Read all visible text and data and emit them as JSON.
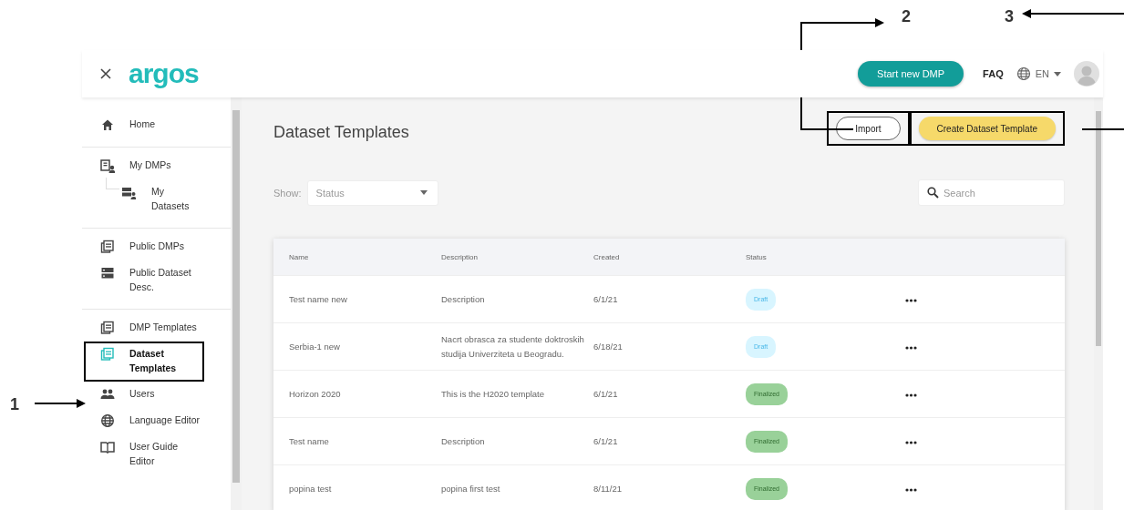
{
  "annotations": [
    {
      "label": "1"
    },
    {
      "label": "2"
    },
    {
      "label": "3"
    }
  ],
  "header": {
    "logo": "argos",
    "start_button": "Start new DMP",
    "faq": "FAQ",
    "language": "EN"
  },
  "sidebar": {
    "sections": [
      {
        "items": [
          {
            "label": "Home",
            "selected": false,
            "highlighted": false
          }
        ]
      },
      {
        "items": [
          {
            "label": "My DMPs",
            "selected": false,
            "highlighted": false,
            "children": [
              {
                "label": "My Datasets",
                "selected": false,
                "highlighted": false
              }
            ]
          }
        ]
      },
      {
        "items": [
          {
            "label": "Public DMPs",
            "selected": false,
            "highlighted": false
          },
          {
            "label": "Public Dataset Desc.",
            "selected": false,
            "highlighted": false
          }
        ]
      },
      {
        "items": [
          {
            "label": "DMP Templates",
            "selected": false,
            "highlighted": false
          },
          {
            "label": "Dataset Templates",
            "selected": true,
            "highlighted": true
          },
          {
            "label": "Users",
            "selected": false,
            "highlighted": false
          },
          {
            "label": "Language Editor",
            "selected": false,
            "highlighted": false
          },
          {
            "label": "User Guide Editor",
            "selected": false,
            "highlighted": false
          }
        ]
      }
    ]
  },
  "page": {
    "title": "Dataset Templates",
    "buttons": [
      {
        "label": "Import",
        "kind": "outline",
        "highlighted": true
      },
      {
        "label": "Create Dataset Template",
        "kind": "primary",
        "highlighted": true
      }
    ],
    "filter": {
      "label": "Show:",
      "placeholder": "Status"
    },
    "search": {
      "placeholder": "Search"
    }
  },
  "table": {
    "columns": [
      "Name",
      "Description",
      "Created",
      "Status"
    ],
    "rows": [
      {
        "name": "Test name new",
        "description": "Description",
        "created": "6/1/21",
        "status": {
          "label": "Draft",
          "kind": "draft"
        }
      },
      {
        "name": "Serbia-1 new",
        "description": "Nacrt obrasca za studente doktroskih studija Univerziteta u Beogradu.",
        "created": "6/18/21",
        "status": {
          "label": "Draft",
          "kind": "draft"
        }
      },
      {
        "name": "Horizon 2020",
        "description": "This is the H2020 template",
        "created": "6/1/21",
        "status": {
          "label": "Finalized",
          "kind": "finalized"
        }
      },
      {
        "name": "Test name",
        "description": "Description",
        "created": "6/1/21",
        "status": {
          "label": "Finalized",
          "kind": "finalized"
        }
      },
      {
        "name": "popina test",
        "description": "popina first test",
        "created": "8/11/21",
        "status": {
          "label": "Finalized",
          "kind": "finalized"
        }
      }
    ]
  }
}
